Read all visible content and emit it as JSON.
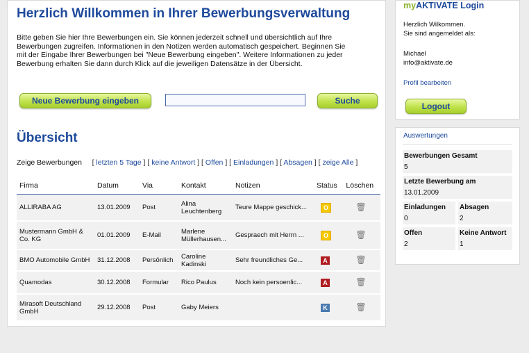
{
  "main": {
    "title": "Herzlich Willkommen in Ihrer Bewerbungsverwaltung",
    "intro": "Bitte geben Sie hier Ihre Bewerbungen ein. Sie können jederzeit schnell und übersichtlich auf Ihre Bewerbungen zugreifen. Informationen in den Notizen werden automatisch gespeichert. Beginnen Sie mit der Eingabe Ihrer Bewerbungen bei \"Neue Bewerbung eingeben\". Weitere Informationen zu jeder Bewerbung erhalten Sie dann durch Klick auf die jeweiligen Datensätze in der Übersicht.",
    "new_button": "Neue Bewerbung eingeben",
    "search_value": "",
    "search_button": "Suche",
    "overview_title": "Übersicht",
    "filter_label": "Zeige Bewerbungen",
    "filters": [
      "letzten 5 Tage",
      "keine Antwort",
      "Offen",
      "Einladungen",
      "Absagen",
      "zeige Alle"
    ]
  },
  "table": {
    "headers": [
      "Firma",
      "Datum",
      "Via",
      "Kontakt",
      "Notizen",
      "Status",
      "Löschen"
    ],
    "rows": [
      {
        "firma": "ALLIRABA AG",
        "datum": "13.01.2009",
        "via": "Post",
        "kontakt": "Alina Leuchtenberg",
        "notizen": "Teure Mappe geschick...",
        "status": "O"
      },
      {
        "firma": "Mustermann GmbH & Co. KG",
        "datum": "01.01.2009",
        "via": "E-Mail",
        "kontakt": "Marlene Müllerhausen...",
        "notizen": "Gespraech mit Herrn ...",
        "status": "O"
      },
      {
        "firma": "BMO Automobile GmbH",
        "datum": "31.12.2008",
        "via": "Persönlich",
        "kontakt": "Caroline Kadinski",
        "notizen": "Sehr freundliches Ge...",
        "status": "A"
      },
      {
        "firma": "Quamodas",
        "datum": "30.12.2008",
        "via": "Formular",
        "kontakt": "Rico Paulus",
        "notizen": "Noch kein persoenlic...",
        "status": "A"
      },
      {
        "firma": "Mirasoft Deutschland GmbH",
        "datum": "29.12.2008",
        "via": "Post",
        "kontakt": "Gaby Meiers",
        "notizen": "",
        "status": "K"
      }
    ]
  },
  "login": {
    "title_prefix": "my",
    "title_rest": "AKTIVATE Login",
    "greeting": "Herzlich Wilkommen.",
    "logged_as": "Sie sind angemeldet als:",
    "user_name": "Michael",
    "user_email": "info@aktivate.de",
    "profile_link": "Profil bearbeiten",
    "logout_button": "Logout"
  },
  "stats": {
    "title": "Auswertungen",
    "total_label": "Bewerbungen Gesamt",
    "total_value": "5",
    "last_label": "Letzte Bewerbung am",
    "last_value": "13.01.2009",
    "einladungen_label": "Einladungen",
    "einladungen_value": "0",
    "absagen_label": "Absagen",
    "absagen_value": "2",
    "offen_label": "Offen",
    "offen_value": "2",
    "keine_label": "Keine Antwort",
    "keine_value": "1"
  },
  "colors": {
    "accent": "#1e4a9c",
    "button": "#bfe24a",
    "open": "#f6c800",
    "rejected": "#b01e22",
    "contact": "#4a7ab0"
  }
}
